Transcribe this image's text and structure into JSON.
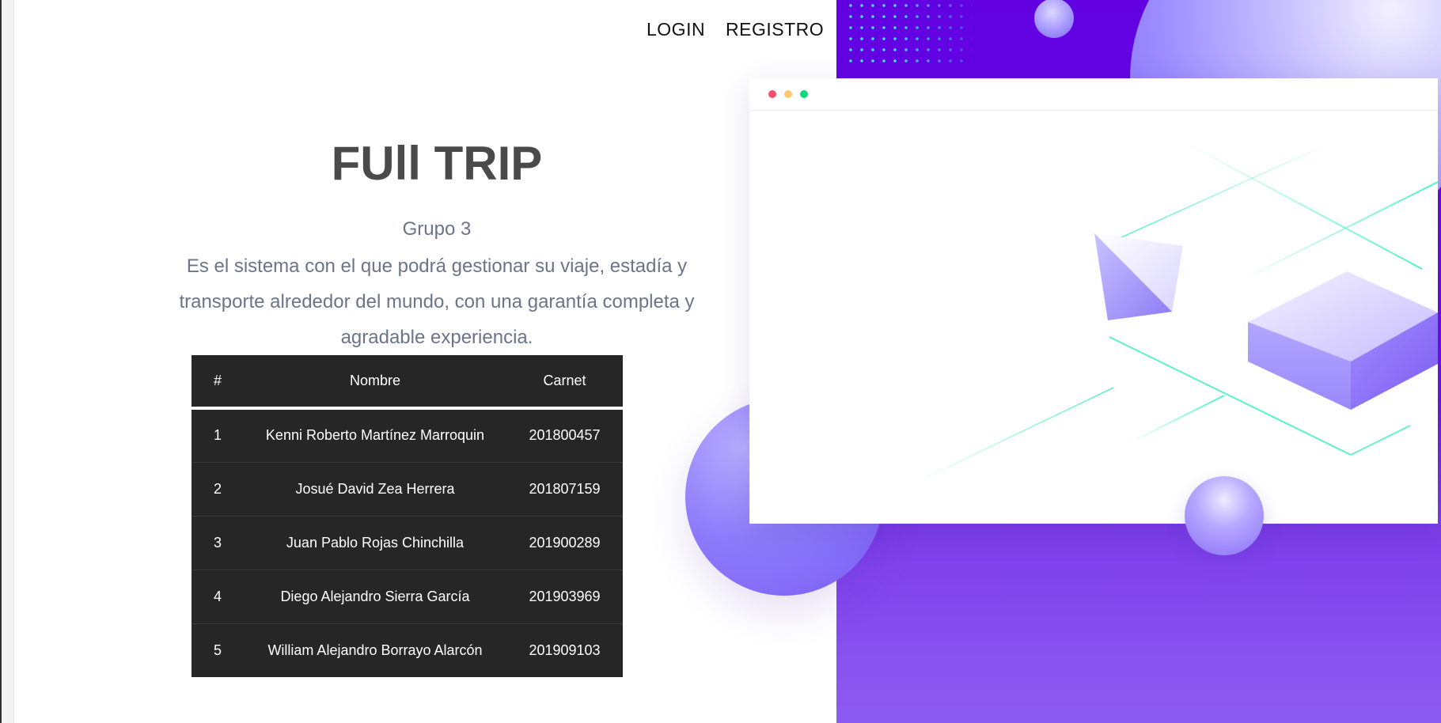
{
  "nav": {
    "login": "LOGIN",
    "registro": "REGISTRO"
  },
  "hero": {
    "title": "FUll TRIP",
    "subtitle": "Grupo 3",
    "description": "Es el sistema con el que podrá gestionar su viaje, estadía y transporte alrededor del mundo, con una garantía completa y agradable experiencia."
  },
  "table": {
    "headers": [
      "#",
      "Nombre",
      "Carnet"
    ],
    "rows": [
      {
        "num": "1",
        "nombre": "Kenni Roberto Martínez Marroquin",
        "carnet": "201800457"
      },
      {
        "num": "2",
        "nombre": "Josué David Zea Herrera",
        "carnet": "201807159"
      },
      {
        "num": "3",
        "nombre": "Juan Pablo Rojas Chinchilla",
        "carnet": "201900289"
      },
      {
        "num": "4",
        "nombre": "Diego Alejandro Sierra García",
        "carnet": "201903969"
      },
      {
        "num": "5",
        "nombre": "William Alejandro Borrayo Alarcón",
        "carnet": "201909103"
      }
    ]
  },
  "colors": {
    "purple_panel": "#6200e2",
    "accent_cyan": "#3fe3ee",
    "table_bg": "#262626",
    "title_text": "#4a4a4a",
    "body_text": "#6b7488"
  },
  "icons": [
    "window-close-dot",
    "window-minimize-dot",
    "window-maximize-dot"
  ]
}
